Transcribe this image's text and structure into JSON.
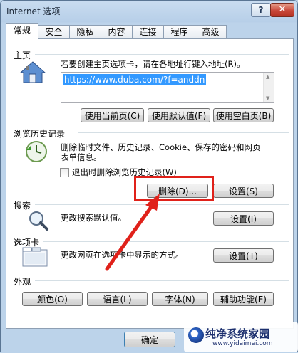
{
  "window": {
    "title": "Internet 选项",
    "help_label": "?",
    "close_label": "✕"
  },
  "tabs": [
    "常规",
    "安全",
    "隐私",
    "内容",
    "连接",
    "程序",
    "高级"
  ],
  "homepage": {
    "section_label": "主页",
    "description": "若要创建主页选项卡，请在各地址行键入地址(R)。",
    "url": "https://www.duba.com/?f=anddn",
    "buttons": [
      "使用当前页(C)",
      "使用默认值(F)",
      "使用空白页(B)"
    ]
  },
  "history": {
    "section_label": "浏览历史记录",
    "description_line1": "删除临时文件、历史记录、Cookie、保存的密码和网页",
    "description_line2": "表单信息。",
    "checkbox_label": "退出时删除浏览历史记录(W)",
    "checkbox_checked": false,
    "delete_label": "删除(D)...",
    "settings_label": "设置(S)"
  },
  "search": {
    "section_label": "搜索",
    "description": "更改搜索默认值。",
    "settings_label": "设置(I)"
  },
  "tabs_section": {
    "section_label": "选项卡",
    "description": "更改网页在选项卡中显示的方式。",
    "settings_label": "设置(T)"
  },
  "appearance": {
    "section_label": "外观",
    "buttons": [
      "颜色(O)",
      "语言(L)",
      "字体(N)",
      "辅助功能(E)"
    ]
  },
  "footer": {
    "ok_label": "确定"
  },
  "watermark": {
    "title": "纯净系统家园",
    "url": "www.yidaimei.com"
  },
  "colors": {
    "highlight": "#e0211a",
    "selection": "#3399ff"
  }
}
